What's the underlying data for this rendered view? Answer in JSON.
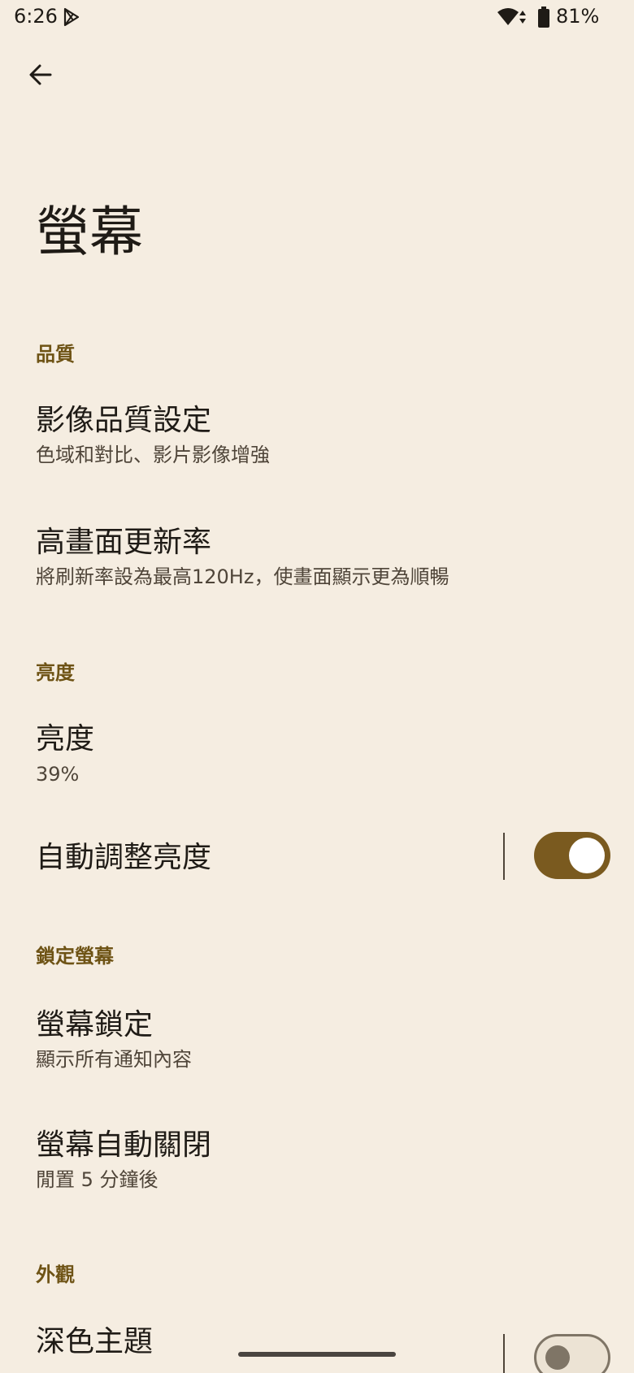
{
  "status_bar": {
    "time": "6:26",
    "battery": "81%",
    "icons": [
      "play-store-icon",
      "wifi-icon",
      "battery-icon"
    ]
  },
  "header": {
    "back_icon": "arrow-left-icon",
    "title": "螢幕"
  },
  "sections": {
    "quality": {
      "header": "品質",
      "image_quality": {
        "title": "影像品質設定",
        "summary": "色域和對比、影片影像增強"
      },
      "refresh_rate": {
        "title": "高畫面更新率",
        "summary": "將刷新率設為最高120Hz，使畫面顯示更為順暢"
      }
    },
    "brightness": {
      "header": "亮度",
      "brightness_level": {
        "title": "亮度",
        "summary": "39%"
      },
      "auto_brightness": {
        "title": "自動調整亮度",
        "enabled": true
      }
    },
    "lock_screen": {
      "header": "鎖定螢幕",
      "screen_lock": {
        "title": "螢幕鎖定",
        "summary": "顯示所有通知內容"
      },
      "screen_timeout": {
        "title": "螢幕自動關閉",
        "summary": "閒置 5 分鐘後"
      }
    },
    "appearance": {
      "header": "外觀",
      "dark_theme": {
        "title": "深色主題",
        "enabled": false
      }
    }
  },
  "colors": {
    "background": "#f5ede1",
    "accent": "#6e5315",
    "switch_on": "#7a5a1f"
  }
}
